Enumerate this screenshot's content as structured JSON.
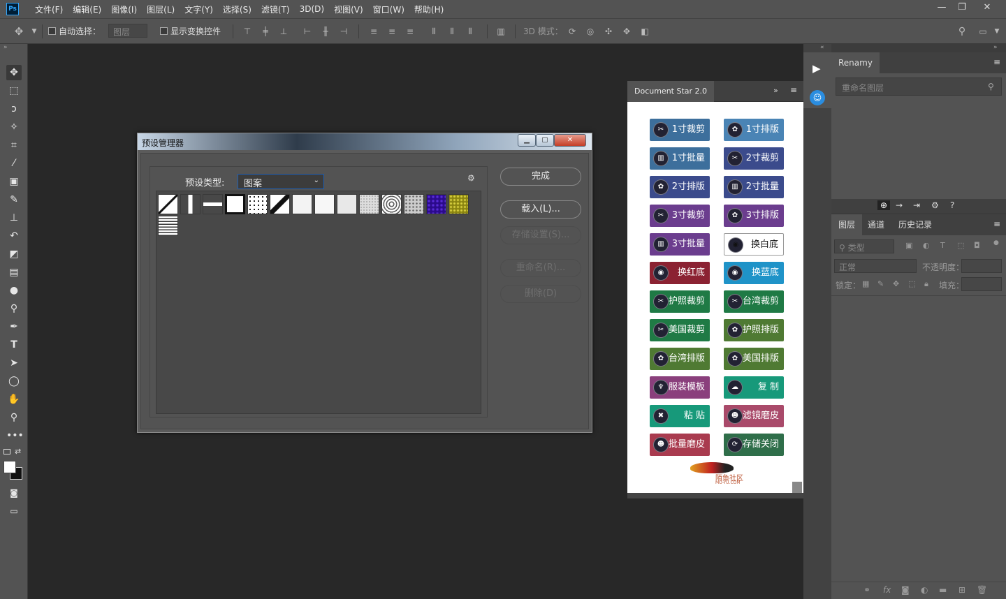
{
  "app": {
    "logo": "Ps"
  },
  "menu": [
    "文件(F)",
    "编辑(E)",
    "图像(I)",
    "图层(L)",
    "文字(Y)",
    "选择(S)",
    "滤镜(T)",
    "3D(D)",
    "视图(V)",
    "窗口(W)",
    "帮助(H)"
  ],
  "window_controls": {
    "min": "—",
    "max": "❐",
    "close": "✕"
  },
  "options": {
    "auto_select": "自动选择：",
    "layer_select": "图层",
    "show_transform": "显示变换控件",
    "mode3d": "3D 模式："
  },
  "tools": [
    "move-tool-icon",
    "marquee-icon",
    "lasso-icon",
    "magic-wand-icon",
    "crop-icon",
    "eyedropper-icon",
    "healing-icon",
    "brush-icon",
    "stamp-icon",
    "history-brush-icon",
    "eraser-icon",
    "gradient-icon",
    "blur-icon",
    "dodge-icon",
    "pen-icon",
    "type-icon",
    "path-select-icon",
    "shape-icon",
    "hand-icon",
    "zoom-icon",
    "more-icon"
  ],
  "dialog": {
    "title": "预设管理器",
    "type_label": "预设类型:",
    "type_value": "图案",
    "buttons": {
      "done": "完成",
      "load": "载入(L)...",
      "save": "存储设置(S)...",
      "rename": "重命名(R)...",
      "delete": "删除(D)"
    }
  },
  "docstar": {
    "title": "Document Star 2.0",
    "buttons": [
      {
        "label": "1寸裁剪",
        "color": "#3d6f9c",
        "icon": "scissors-icon"
      },
      {
        "label": "1寸排版",
        "color": "#4a84b5",
        "icon": "layout-icon"
      },
      {
        "label": "1寸批量",
        "color": "#3d6f9c",
        "icon": "chart-icon"
      },
      {
        "label": "2寸裁剪",
        "color": "#3b4b8c",
        "icon": "scissors-icon"
      },
      {
        "label": "2寸排版",
        "color": "#3b4b8c",
        "icon": "layout-icon"
      },
      {
        "label": "2寸批量",
        "color": "#3b4b8c",
        "icon": "chart-icon"
      },
      {
        "label": "3寸裁剪",
        "color": "#6b3d8e",
        "icon": "scissors-icon"
      },
      {
        "label": "3寸排版",
        "color": "#6b3d8e",
        "icon": "layout-icon"
      },
      {
        "label": "3寸批量",
        "color": "#6b3d8e",
        "icon": "chart-icon"
      },
      {
        "label": "换白底",
        "color": "#ffffff",
        "icon": "film-icon"
      },
      {
        "label": "换红底",
        "color": "#8b2232",
        "icon": "film-icon"
      },
      {
        "label": "换蓝底",
        "color": "#1f93c8",
        "icon": "film-icon"
      },
      {
        "label": "护照裁剪",
        "color": "#1f7a45",
        "icon": "scissors-icon"
      },
      {
        "label": "台湾裁剪",
        "color": "#1f7a45",
        "icon": "scissors-icon"
      },
      {
        "label": "美国裁剪",
        "color": "#1f7a45",
        "icon": "scissors-icon"
      },
      {
        "label": "护照排版",
        "color": "#4f7a33",
        "icon": "layout-icon"
      },
      {
        "label": "台湾排版",
        "color": "#4f7a33",
        "icon": "layout-icon"
      },
      {
        "label": "美国排版",
        "color": "#4f7a33",
        "icon": "layout-icon"
      },
      {
        "label": "服装模板",
        "color": "#8a3f7c",
        "icon": "shirt-icon"
      },
      {
        "label": "复  制",
        "color": "#17997a",
        "icon": "cloud-icon"
      },
      {
        "label": "粘  贴",
        "color": "#17997a",
        "icon": "paste-icon"
      },
      {
        "label": "滤镜磨皮",
        "color": "#a94a6a",
        "icon": "person-icon"
      },
      {
        "label": "批量磨皮",
        "color": "#a93b4f",
        "icon": "person-icon"
      },
      {
        "label": "存储关闭",
        "color": "#2f6e4a",
        "icon": "save-icon"
      }
    ],
    "logo_text": "陌鱼社区",
    "logo_sub": "MO-YU.COM"
  },
  "renamy": {
    "tab": "Renamy",
    "placeholder": "重命名图层"
  },
  "layers": {
    "tabs": [
      "图层",
      "通道",
      "历史记录"
    ],
    "kind": "类型",
    "blend": "正常",
    "opacity": "不透明度：",
    "lock": "锁定：",
    "fill": "填充："
  }
}
